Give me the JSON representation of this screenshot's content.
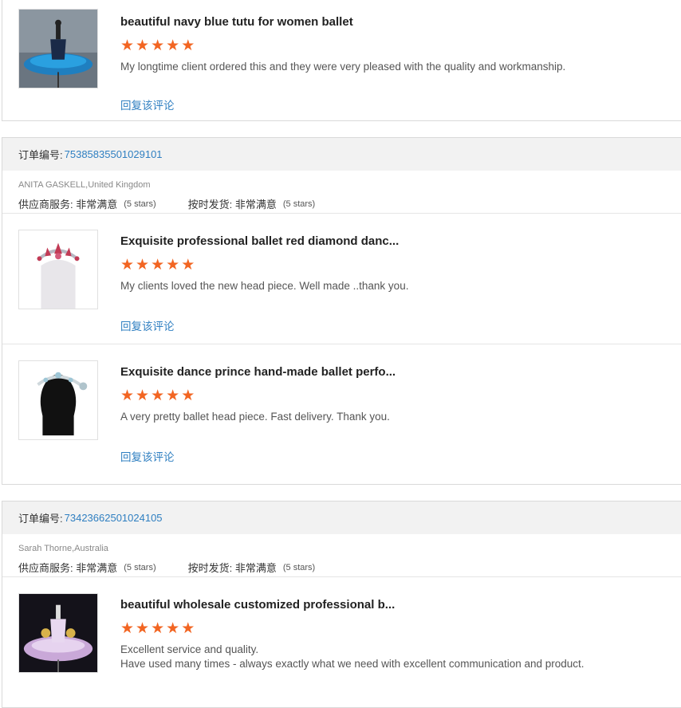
{
  "star_color": "#f26522",
  "link_color": "#2f7fc1",
  "order_label": "订单编号:",
  "reply_label": "回复该评论",
  "supplier_service_label": "供应商服务:",
  "ontime_label": "按时发货:",
  "top_item": {
    "title": "beautiful navy blue tutu for women ballet",
    "review": "My longtime client ordered this and they were very pleased with the quality and workmanship.",
    "stars": 5
  },
  "orders": [
    {
      "number": "75385835501029101",
      "buyer": "ANITA GASKELL,United Kingdom",
      "supplier_service": "非常满意",
      "supplier_stars": "(5 stars)",
      "ontime": "非常满意",
      "ontime_stars": "(5 stars)",
      "items": [
        {
          "title": "Exquisite professional ballet red diamond danc...",
          "review": "My clients loved the new head piece. Well made ..thank you.",
          "stars": 5
        },
        {
          "title": "Exquisite dance prince hand-made ballet perfo...",
          "review": "A very pretty ballet head piece. Fast delivery. Thank you.",
          "stars": 5
        }
      ]
    },
    {
      "number": "73423662501024105",
      "buyer": "Sarah Thorne,Australia",
      "supplier_service": "非常满意",
      "supplier_stars": "(5 stars)",
      "ontime": "非常满意",
      "ontime_stars": "(5 stars)",
      "items": [
        {
          "title": "beautiful wholesale customized professional b...",
          "review_line1": "Excellent service and quality.",
          "review_line2": "Have used many times - always exactly what we need with excellent communication and product.",
          "stars": 5
        }
      ]
    }
  ]
}
